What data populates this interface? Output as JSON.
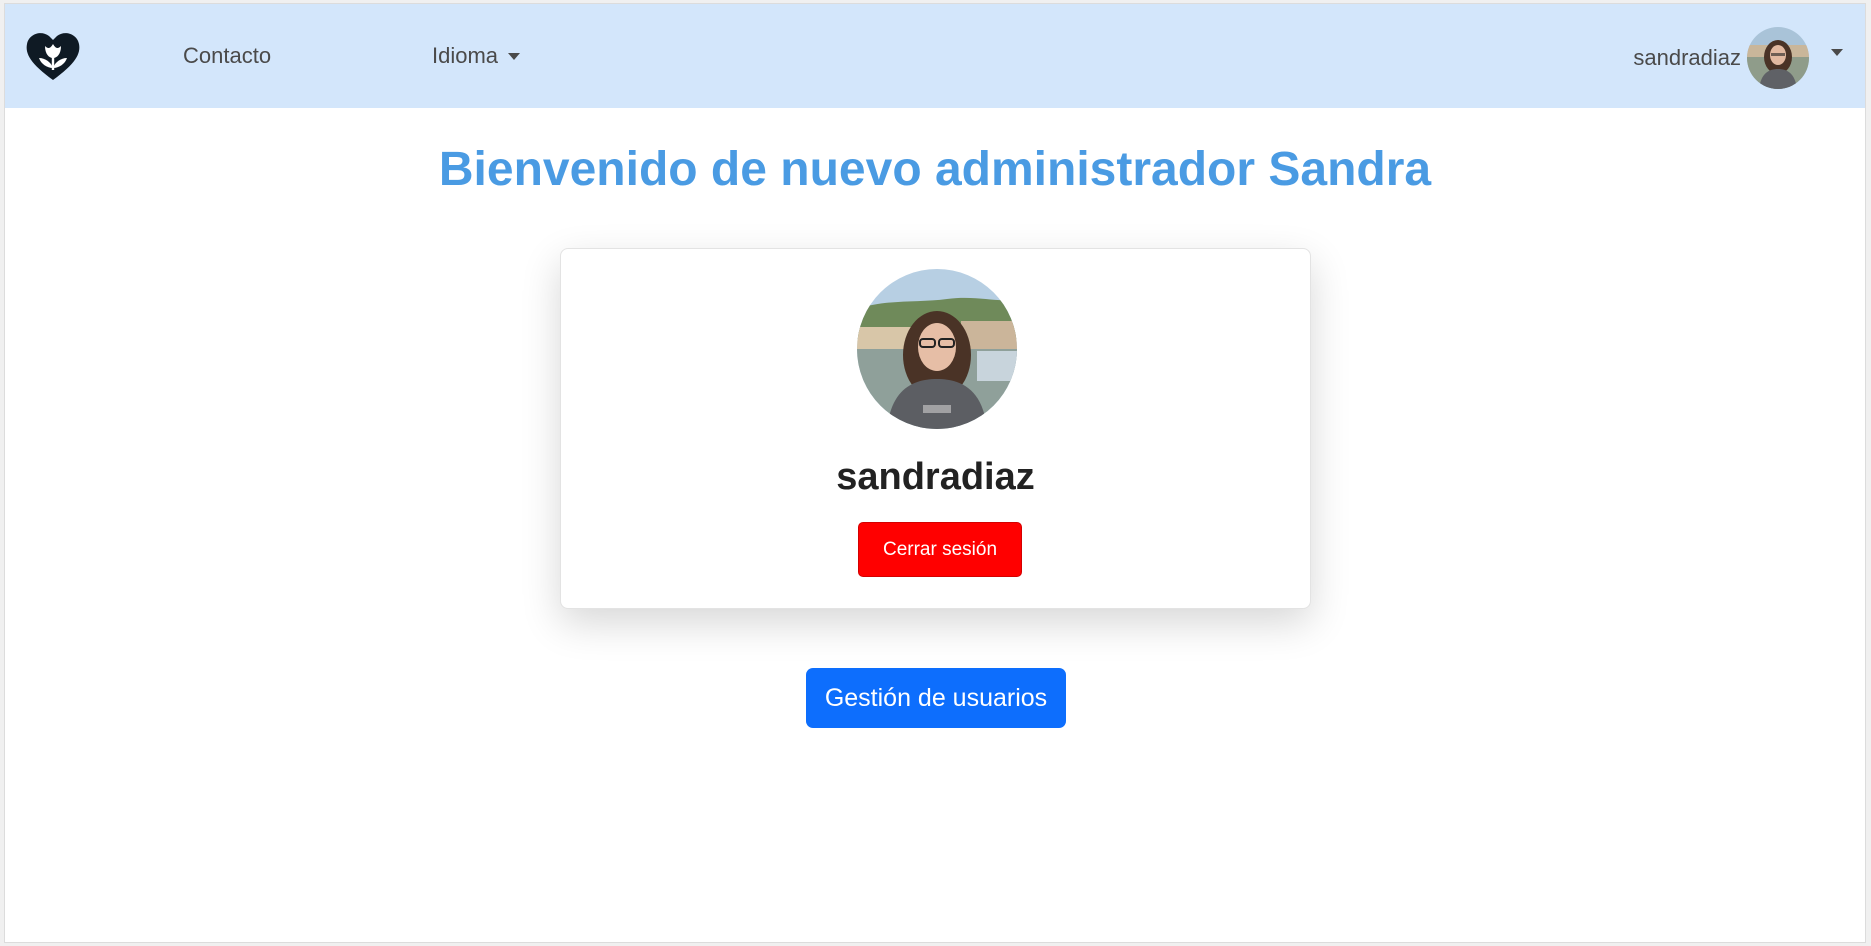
{
  "navbar": {
    "logo_icon": "heart-tulip-logo-icon",
    "links": {
      "contact_label": "Contacto",
      "language_label": "Idioma"
    },
    "user_menu": {
      "username": "sandradiaz",
      "avatar_icon": "user-avatar-photo"
    }
  },
  "main": {
    "welcome_title": "Bienvenido de nuevo administrador Sandra",
    "profile_card": {
      "username": "sandradiaz",
      "logout_label": "Cerrar sesión"
    },
    "manage_users_label": "Gestión de usuarios"
  },
  "colors": {
    "navbar_bg": "#d3e6fb",
    "title": "#4a9be3",
    "logout": "#ff0000",
    "primary": "#0d6efd"
  }
}
